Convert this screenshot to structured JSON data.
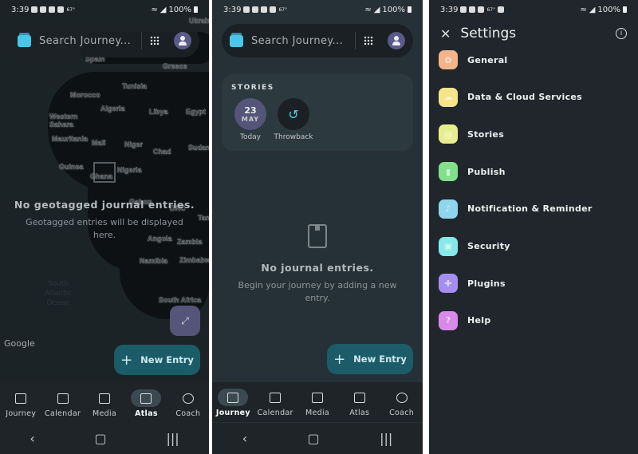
{
  "status_bar": {
    "time": "3:39",
    "temp": "67°",
    "battery": "100%"
  },
  "search": {
    "placeholder": "Search Journey..."
  },
  "bottom_nav": [
    {
      "label": "Journey",
      "icon": "journal-stack-icon"
    },
    {
      "label": "Calendar",
      "icon": "calendar-icon"
    },
    {
      "label": "Media",
      "icon": "image-icon"
    },
    {
      "label": "Atlas",
      "icon": "map-icon"
    },
    {
      "label": "Coach",
      "icon": "heart-circle-icon"
    }
  ],
  "atlas": {
    "active_tab": "Atlas",
    "empty_title": "No geotagged journal entries.",
    "empty_subtitle": "Geotagged entries will be displayed here.",
    "map_attribution": "Google",
    "map_labels": [
      "Ukrain",
      "Spain",
      "Greece",
      "Tunisia",
      "Morocco",
      "Algeria",
      "Libya",
      "Egypt",
      "Western Sahara",
      "Mauritania",
      "Mali",
      "Niger",
      "Chad",
      "Sudan",
      "Guinea",
      "Nigeria",
      "Ghana",
      "Gabon",
      "DRC",
      "Tan",
      "Angola",
      "Zambia",
      "Namibia",
      "Zimbabw",
      "South Africa"
    ],
    "ocean_label": "South Atlantic Ocean",
    "new_entry": "New Entry"
  },
  "journey": {
    "active_tab": "Journey",
    "stories_header": "STORIES",
    "stories": [
      {
        "day": "23",
        "month": "MAY",
        "label": "Today"
      },
      {
        "label": "Throwback",
        "icon": "history-icon"
      }
    ],
    "empty_title": "No journal entries.",
    "empty_subtitle": "Begin your journey by adding a new entry.",
    "new_entry": "New Entry"
  },
  "settings": {
    "title": "Settings",
    "items": [
      {
        "label": "General",
        "color": "#f3b48a"
      },
      {
        "label": "Data & Cloud Services",
        "color": "#f5e48a"
      },
      {
        "label": "Stories",
        "color": "#e6ee8e"
      },
      {
        "label": "Publish",
        "color": "#82e08a"
      },
      {
        "label": "Notification & Reminder",
        "color": "#8fd6ec"
      },
      {
        "label": "Security",
        "color": "#86e8e8"
      },
      {
        "label": "Plugins",
        "color": "#a48ef0"
      },
      {
        "label": "Help",
        "color": "#d88ae8"
      }
    ]
  }
}
